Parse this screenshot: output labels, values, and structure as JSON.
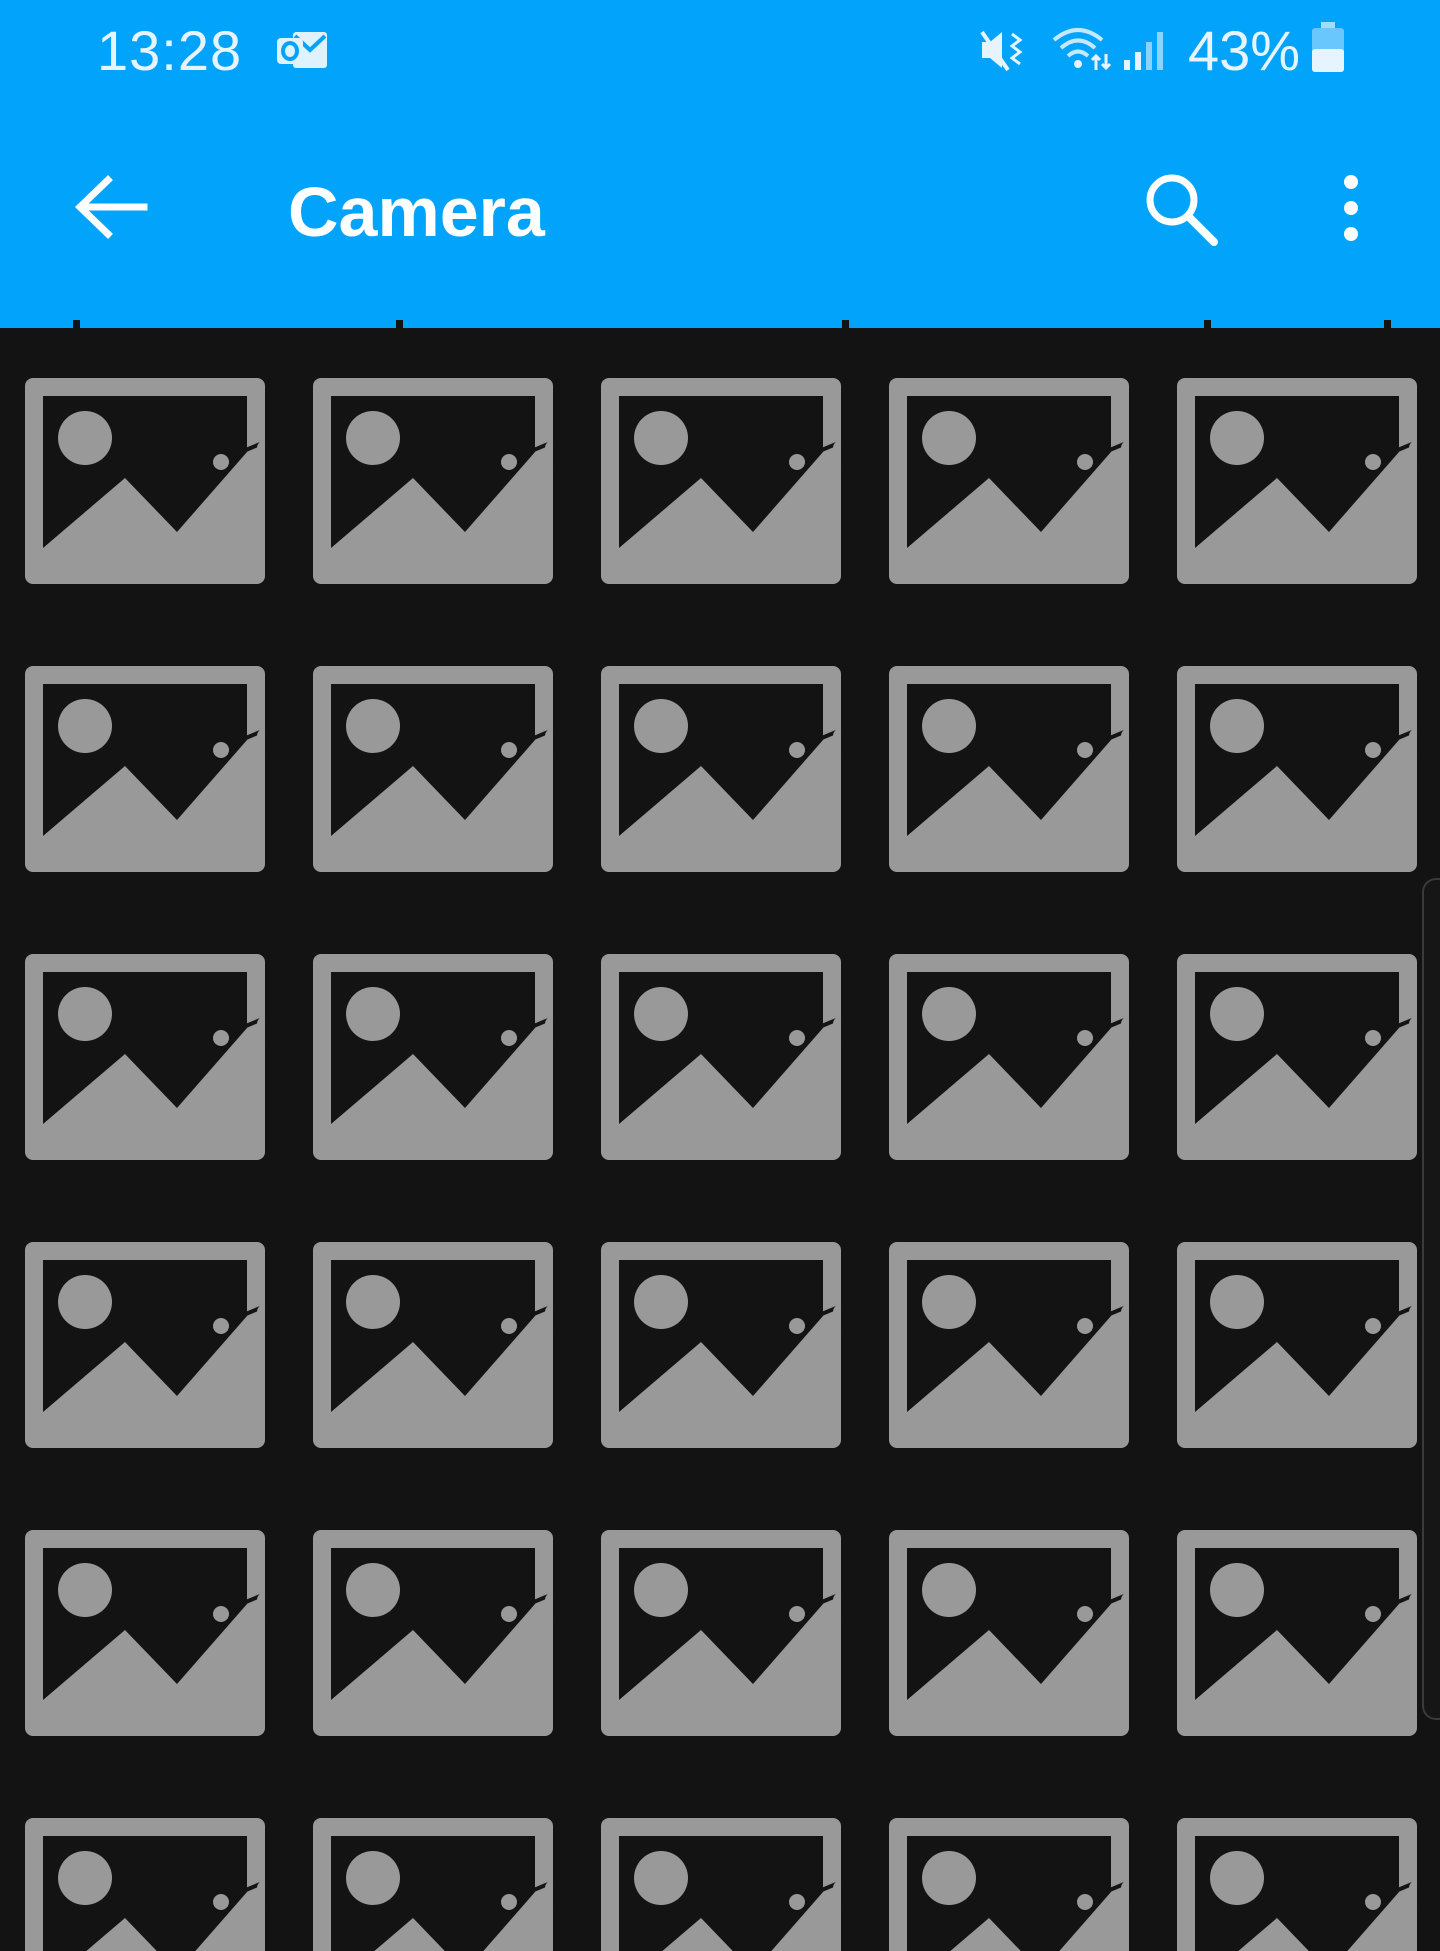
{
  "status_bar": {
    "time": "13:28",
    "battery": "43%",
    "icons": [
      "outlook-icon",
      "mute-icon",
      "wifi-icon",
      "signal-icon",
      "battery-icon"
    ]
  },
  "app_bar": {
    "title": "Camera",
    "icons": [
      "back-arrow-icon",
      "search-icon",
      "more-vert-icon"
    ]
  },
  "gallery": {
    "columns": 5,
    "visible_rows": 6,
    "placeholder_icon": "image-placeholder-icon"
  },
  "colors": {
    "accent": "#02a3fb",
    "background": "#131313",
    "placeholder": "#999999"
  }
}
